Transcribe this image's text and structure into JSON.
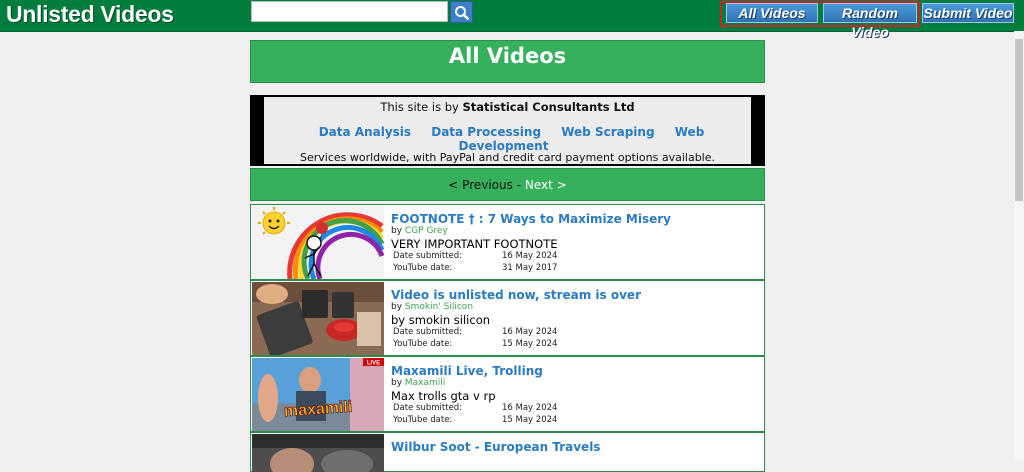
{
  "header": {
    "logo": "Unlisted Videos",
    "search": {
      "value": "",
      "placeholder": ""
    },
    "nav": [
      {
        "label": "All Videos"
      },
      {
        "label": "Random Video"
      },
      {
        "label": "Submit Video"
      }
    ]
  },
  "page": {
    "title": "All Videos"
  },
  "ad": {
    "line1_prefix": "This site is by ",
    "line1_company": "Statistical Consultants Ltd",
    "links": [
      "Data Analysis",
      "Data Processing",
      "Web Scraping",
      "Web Development"
    ],
    "line3": "Services worldwide, with PayPal and credit card payment options available."
  },
  "pager": {
    "previous": "< Previous",
    "separator": " - ",
    "next": "Next >"
  },
  "labels": {
    "by": "by ",
    "date_submitted": "Date submitted:",
    "youtube_date": "YouTube date:"
  },
  "videos": [
    {
      "title": "FOOTNOTE † : 7 Ways to Maximize Misery",
      "channel": "CGP Grey",
      "description": "VERY IMPORTANT FOOTNOTE",
      "date_submitted": "16 May 2024",
      "youtube_date": "31 May 2017"
    },
    {
      "title": "Video is unlisted now, stream is over",
      "channel": "Smokin' Silicon",
      "description": "by smokin silicon",
      "date_submitted": "16 May 2024",
      "youtube_date": "15 May 2024"
    },
    {
      "title": "Maxamili Live, Trolling",
      "channel": "Maxamili",
      "description": "Max trolls gta v rp",
      "date_submitted": "16 May 2024",
      "youtube_date": "15 May 2024",
      "thumb_text": "maxamili",
      "live_badge": "LIVE"
    },
    {
      "title": "Wilbur Soot - European Travels"
    }
  ],
  "colors": {
    "header_bg": "#017d3e",
    "green": "#37b05d",
    "link_blue": "#2b7bc2",
    "nav_highlight": "#c8222a"
  }
}
